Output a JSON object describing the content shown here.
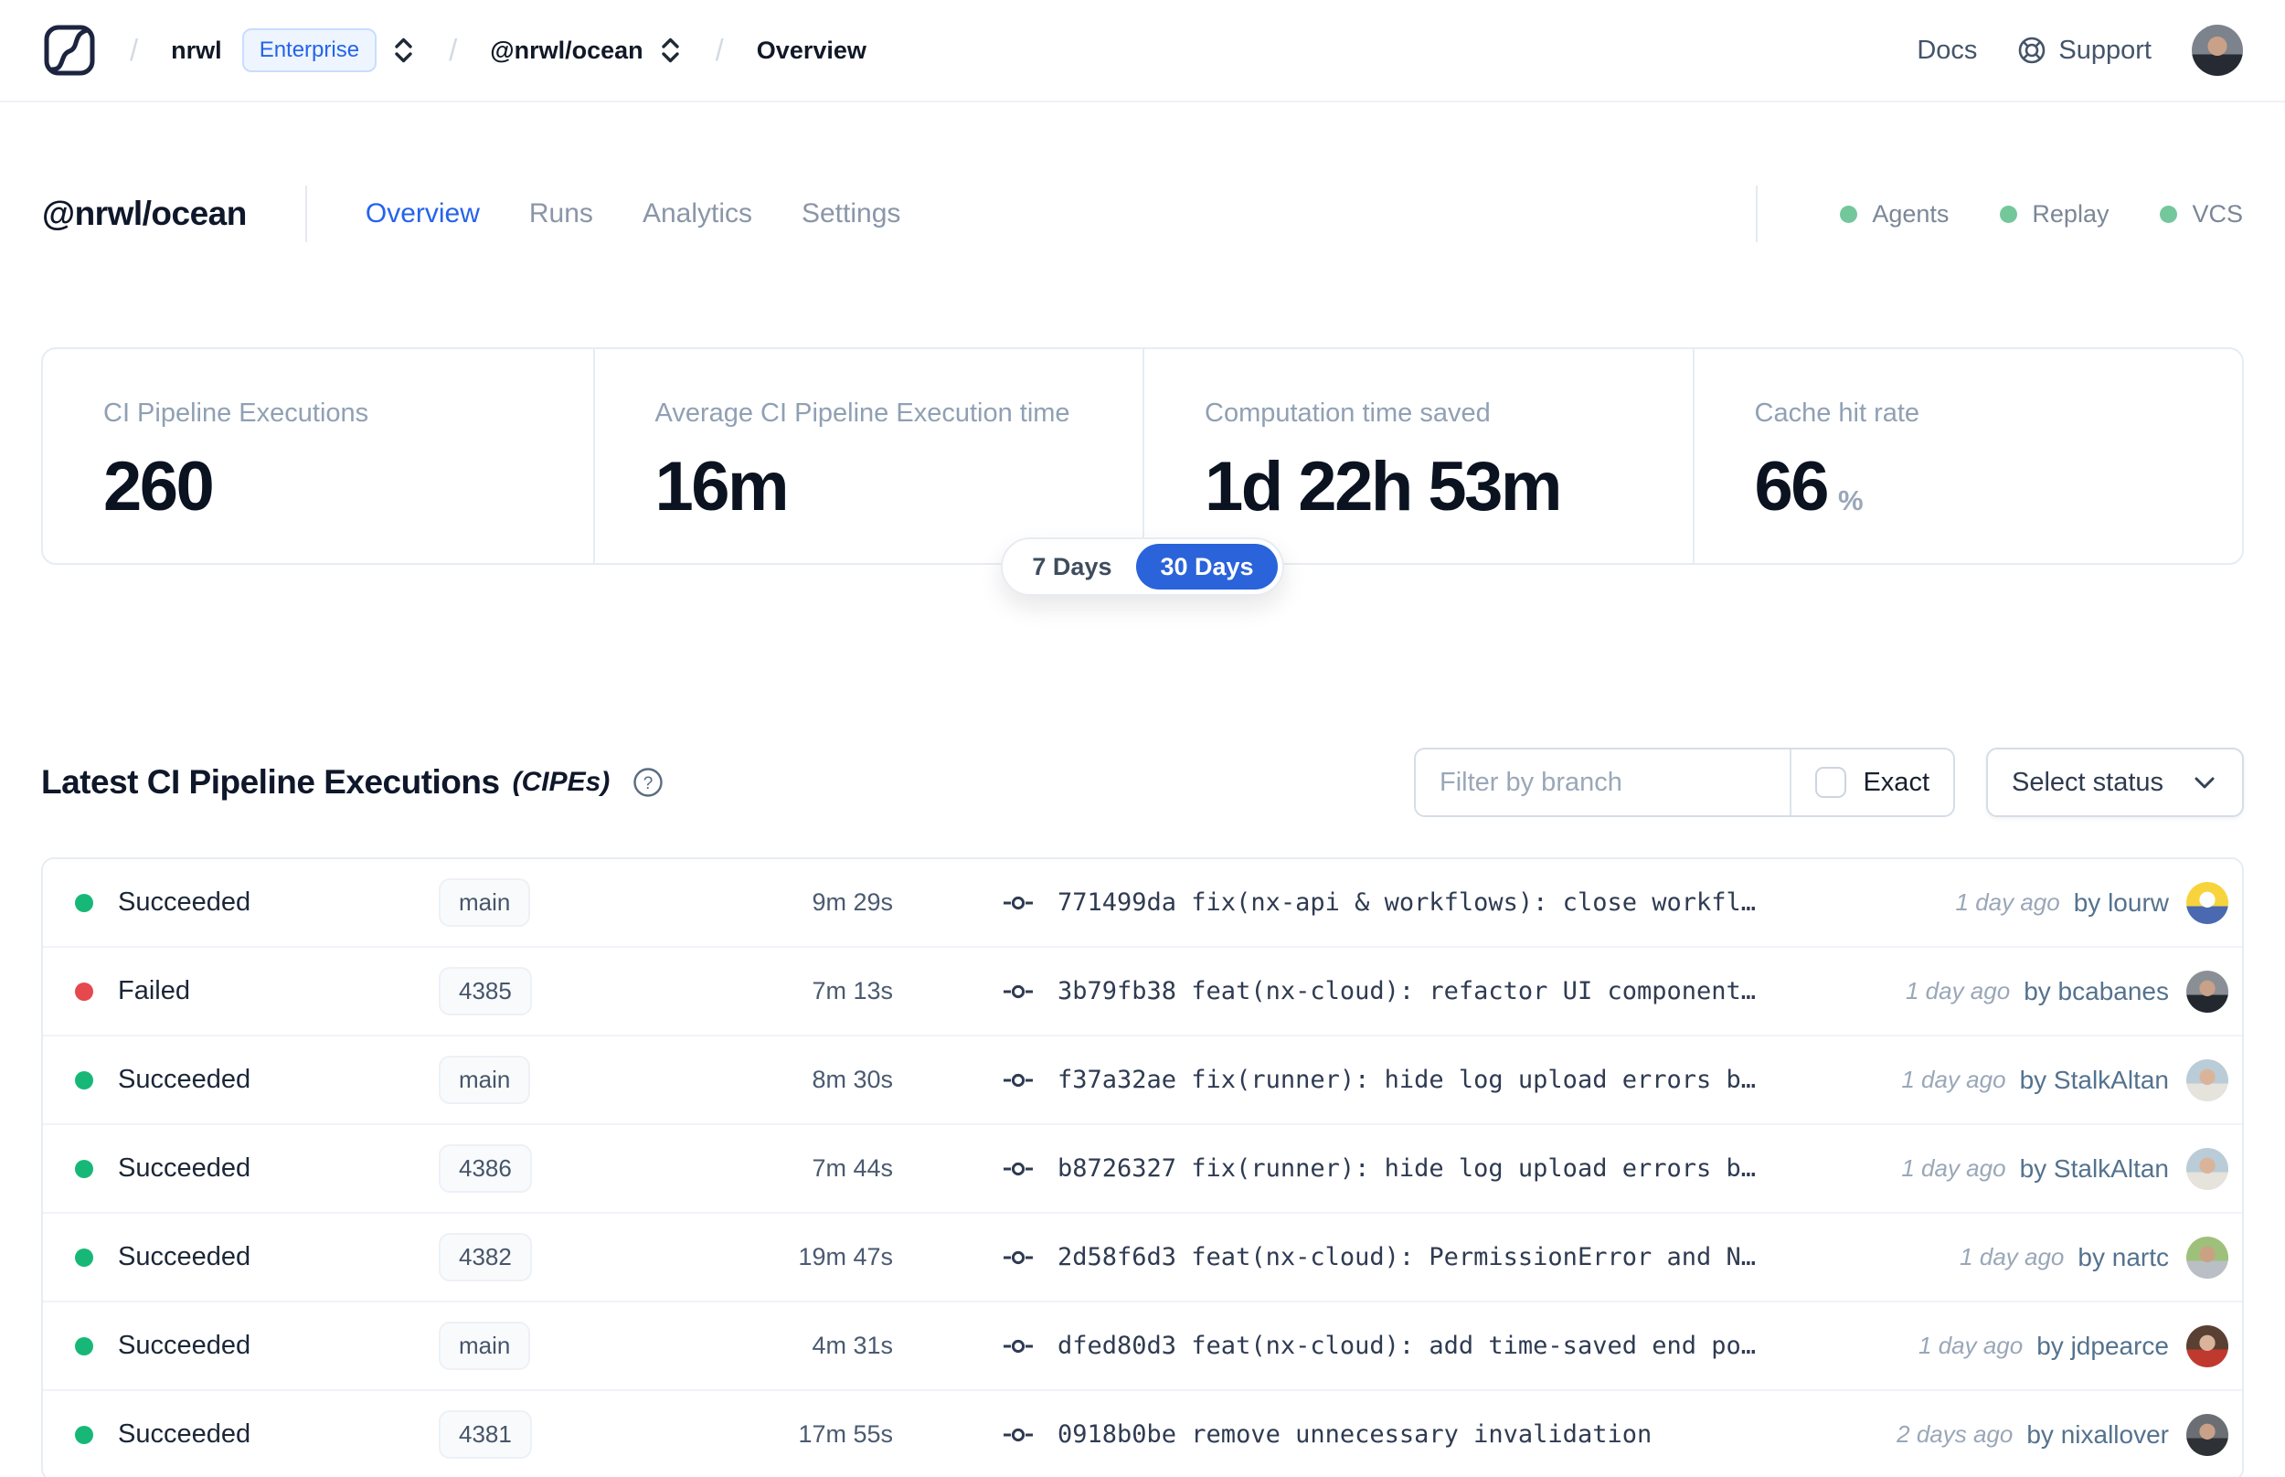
{
  "header": {
    "separator": "/",
    "breadcrumb": {
      "org": "nrwl",
      "badge": "Enterprise",
      "workspace": "@nrwl/ocean",
      "page": "Overview"
    },
    "nav": {
      "docs": "Docs",
      "support": "Support"
    },
    "user": {
      "avatar": {
        "c1": "#7d838c",
        "c2": "#262b33",
        "c3": "#c9a188"
      }
    }
  },
  "workspace": {
    "title": "@nrwl/ocean",
    "tabs": [
      {
        "label": "Overview",
        "active": true
      },
      {
        "label": "Runs",
        "active": false
      },
      {
        "label": "Analytics",
        "active": false
      },
      {
        "label": "Settings",
        "active": false
      }
    ],
    "features": [
      {
        "label": "Agents"
      },
      {
        "label": "Replay"
      },
      {
        "label": "VCS"
      }
    ]
  },
  "stats": {
    "cards": [
      {
        "label": "CI Pipeline Executions",
        "value": "260",
        "suffix": ""
      },
      {
        "label": "Average CI Pipeline Execution time",
        "value": "16m",
        "suffix": ""
      },
      {
        "label": "Computation time saved",
        "value": "1d 22h 53m",
        "suffix": ""
      },
      {
        "label": "Cache hit rate",
        "value": "66",
        "suffix": "%"
      }
    ],
    "range_toggle": {
      "options": [
        "7 Days",
        "30 Days"
      ],
      "selected": "30 Days"
    }
  },
  "cipes": {
    "title": "Latest CI Pipeline Executions",
    "title_suffix": "(CIPEs)",
    "filter_placeholder": "Filter by branch",
    "exact_label": "Exact",
    "status_dropdown_label": "Select status",
    "rows": [
      {
        "status": "Succeeded",
        "branch": "main",
        "duration": "9m 29s",
        "commit": "771499da fix(nx-api & workflows): close workfl…",
        "time": "1 day ago",
        "author": "by lourw",
        "avatar": {
          "c1": "#f7d43c",
          "c2": "#4a69b0",
          "c3": "#fdfdfd"
        }
      },
      {
        "status": "Failed",
        "branch": "4385",
        "duration": "7m 13s",
        "commit": "3b79fb38 feat(nx-cloud): refactor UI component…",
        "time": "1 day ago",
        "author": "by bcabanes",
        "avatar": {
          "c1": "#8a8f96",
          "c2": "#23272e",
          "c3": "#c9a188"
        }
      },
      {
        "status": "Succeeded",
        "branch": "main",
        "duration": "8m 30s",
        "commit": "f37a32ae fix(runner): hide log upload errors b…",
        "time": "1 day ago",
        "author": "by StalkAltan",
        "avatar": {
          "c1": "#b9ccd8",
          "c2": "#e6e2dc",
          "c3": "#d9b49a"
        }
      },
      {
        "status": "Succeeded",
        "branch": "4386",
        "duration": "7m 44s",
        "commit": "b8726327 fix(runner): hide log upload errors b…",
        "time": "1 day ago",
        "author": "by StalkAltan",
        "avatar": {
          "c1": "#b9ccd8",
          "c2": "#e6e2dc",
          "c3": "#d9b49a"
        }
      },
      {
        "status": "Succeeded",
        "branch": "4382",
        "duration": "19m 47s",
        "commit": "2d58f6d3 feat(nx-cloud): PermissionError and N…",
        "time": "1 day ago",
        "author": "by nartc",
        "avatar": {
          "c1": "#9ec07a",
          "c2": "#b9bfc4",
          "c3": "#caa183"
        }
      },
      {
        "status": "Succeeded",
        "branch": "main",
        "duration": "4m 31s",
        "commit": "dfed80d3 feat(nx-cloud): add time-saved end po…",
        "time": "1 day ago",
        "author": "by jdpearce",
        "avatar": {
          "c1": "#5a3f33",
          "c2": "#c0392f",
          "c3": "#d9b49a"
        }
      },
      {
        "status": "Succeeded",
        "branch": "4381",
        "duration": "17m 55s",
        "commit": "0918b0be remove unnecessary invalidation",
        "time": "2 days ago",
        "author": "by nixallover",
        "avatar": {
          "c1": "#6b6f74",
          "c2": "#2e3237",
          "c3": "#c9a188"
        }
      }
    ]
  },
  "colors": {
    "accent_blue": "#2563eb",
    "pill_blue": "#2a63da",
    "succeeded_green": "#17b877",
    "failed_red": "#e5484d",
    "feature_dot_green": "#74c79b"
  }
}
